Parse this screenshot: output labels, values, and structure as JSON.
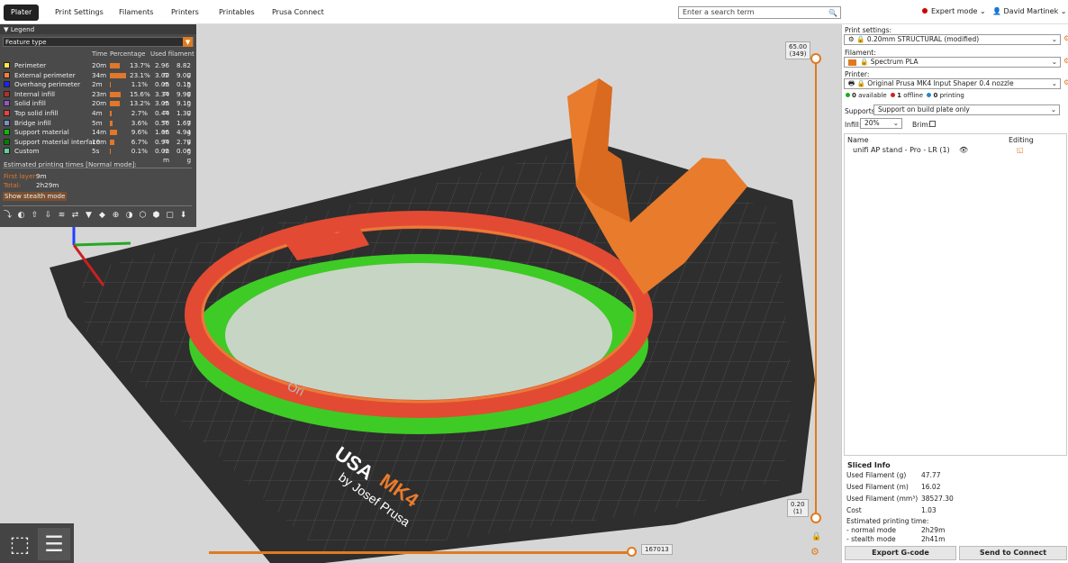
{
  "tabs": [
    "Plater",
    "Print Settings",
    "Filaments",
    "Printers",
    "Printables",
    "Prusa Connect"
  ],
  "active_tab": "Plater",
  "search": {
    "placeholder": "Enter a search term"
  },
  "mode": {
    "label": "Expert mode",
    "color": "#cc0000"
  },
  "user": {
    "name": "David Martinek"
  },
  "legend": {
    "title": "Legend",
    "view_type": "Feature type",
    "columns": {
      "time": "Time",
      "percentage": "Percentage",
      "filament": "Used filament"
    },
    "rows": [
      {
        "name": "Perimeter",
        "color": "#ffe84a",
        "time": "20m",
        "pct": "13.7%",
        "pct_value": 13.7,
        "m": "2.96 m",
        "g": "8.82 g"
      },
      {
        "name": "External perimeter",
        "color": "#ff7d38",
        "time": "34m",
        "pct": "23.1%",
        "pct_value": 23.1,
        "m": "3.02 m",
        "g": "9.00 g"
      },
      {
        "name": "Overhang perimeter",
        "color": "#1f1fff",
        "time": "2m",
        "pct": "1.1%",
        "pct_value": 1.1,
        "m": "0.05 m",
        "g": "0.15 g"
      },
      {
        "name": "Internal infill",
        "color": "#b03029",
        "time": "23m",
        "pct": "15.6%",
        "pct_value": 15.6,
        "m": "3.34 m",
        "g": "9.96 g"
      },
      {
        "name": "Solid infill",
        "color": "#9654cc",
        "time": "20m",
        "pct": "13.2%",
        "pct_value": 13.2,
        "m": "3.05 m",
        "g": "9.10 g"
      },
      {
        "name": "Top solid infill",
        "color": "#f04040",
        "time": "4m",
        "pct": "2.7%",
        "pct_value": 2.7,
        "m": "0.44 m",
        "g": "1.30 g"
      },
      {
        "name": "Bridge infill",
        "color": "#7c8ccc",
        "time": "5m",
        "pct": "3.6%",
        "pct_value": 3.6,
        "m": "0.56 m",
        "g": "1.67 g"
      },
      {
        "name": "Support material",
        "color": "#00c000",
        "time": "14m",
        "pct": "9.6%",
        "pct_value": 9.6,
        "m": "1.66 m",
        "g": "4.94 g"
      },
      {
        "name": "Support material interface",
        "color": "#008000",
        "time": "10m",
        "pct": "6.7%",
        "pct_value": 6.7,
        "m": "0.94 m",
        "g": "2.79 g"
      },
      {
        "name": "Custom",
        "color": "#5ed194",
        "time": "5s",
        "pct": "0.1%",
        "pct_value": 0.1,
        "m": "0.02 m",
        "g": "0.06 g"
      }
    ],
    "est_title": "Estimated printing times [Normal mode]:",
    "first_layer_label": "First layer:",
    "first_layer_value": "9m",
    "total_label": "Total:",
    "total_value": "2h29m",
    "stealth_button": "Show stealth mode"
  },
  "layer_slider": {
    "top": "65.00",
    "top_layer": "(349)",
    "bottom": "0.20",
    "bottom_layer": "(1)"
  },
  "move_slider": {
    "value": "167013"
  },
  "right": {
    "print_settings_label": "Print settings:",
    "print_settings_value": "0.20mm STRUCTURAL (modified)",
    "filament_label": "Filament:",
    "filament_value": "Spectrum PLA",
    "filament_color": "#e07a20",
    "printer_label": "Printer:",
    "printer_value": "Original Prusa MK4 Input Shaper 0.4 nozzle",
    "available": "0",
    "available_text": "available",
    "offline": "1",
    "offline_text": "offline",
    "printing": "0",
    "printing_text": "printing",
    "supports_label": "Supports:",
    "supports_value": "Support on build plate only",
    "infill_label": "Infill:",
    "infill_value": "20%",
    "brim_label": "Brim:",
    "col_name": "Name",
    "col_editing": "Editing",
    "object_name": "unifi AP stand - Pro - LR (1)"
  },
  "sliced_info": {
    "title": "Sliced Info",
    "rows": [
      {
        "label": "Used Filament (g)",
        "value": "47.77"
      },
      {
        "label": "Used Filament (m)",
        "value": "16.02"
      },
      {
        "label": "Used Filament (mm³)",
        "value": "38527.30"
      },
      {
        "label": "Cost",
        "value": "1.03"
      }
    ],
    "est_label": "Estimated printing time:",
    "normal_label": "- normal mode",
    "normal_value": "2h29m",
    "stealth_label": "- stealth mode",
    "stealth_value": "2h41m"
  },
  "buttons": {
    "export": "Export G-code",
    "send": "Send to Connect"
  },
  "bed_text": {
    "brand_a": "USA",
    "brand_b": "MK4",
    "sub": "by Josef Prusa",
    "op": "Ori"
  }
}
